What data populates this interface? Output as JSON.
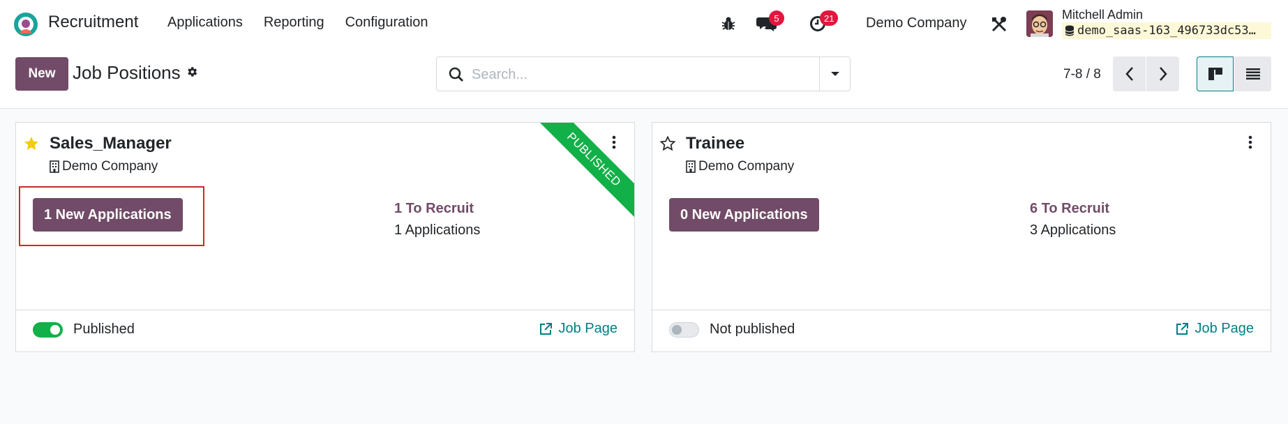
{
  "navbar": {
    "app_name": "Recruitment",
    "menu": [
      "Applications",
      "Reporting",
      "Configuration"
    ],
    "chat_badge": "5",
    "activity_badge": "21",
    "company": "Demo Company",
    "user_name": "Mitchell Admin",
    "database": "demo_saas-163_496733dc53…",
    "accent_color": "#714b67"
  },
  "control_panel": {
    "new_label": "New",
    "title": "Job Positions",
    "search_placeholder": "Search...",
    "pager": "7-8 / 8"
  },
  "cards": [
    {
      "name": "Sales_Manager",
      "company": "Demo Company",
      "favorite": true,
      "ribbon": "PUBLISHED",
      "new_applications": "1 New Applications",
      "to_recruit": "1 To Recruit",
      "applications": "1 Applications",
      "published": true,
      "published_label": "Published",
      "job_page": "Job Page"
    },
    {
      "name": "Trainee",
      "company": "Demo Company",
      "favorite": false,
      "new_applications": "0 New Applications",
      "to_recruit": "6 To Recruit",
      "applications": "3 Applications",
      "published": false,
      "published_label": "Not published",
      "job_page": "Job Page"
    }
  ]
}
